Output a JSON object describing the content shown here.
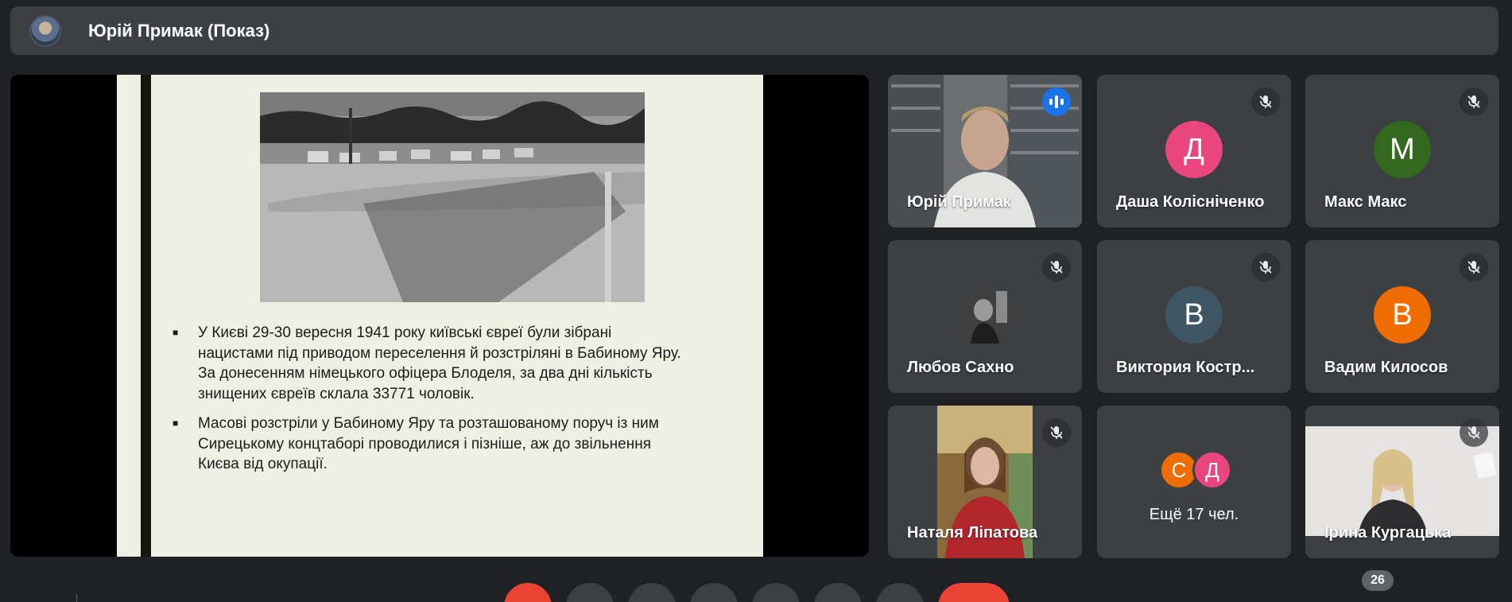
{
  "header": {
    "presenter_title": "Юрій Примак (Показ)"
  },
  "slide": {
    "bullets": [
      "У Києві 29-30 вересня 1941 року київські євреї були зібрані\nнацистами під приводом переселення й розстріляні в Бабиному Яру.\nЗа донесенням німецького офіцера Блоделя, за два дні кількість\nзнищених євреїв склала 33771 чоловік.",
      "Масові розстріли у Бабиному Яру та розташованому поруч із ним\nСирецькому концтаборі проводилися і пізніше, аж до звільнення\nКиєва від окупації."
    ]
  },
  "participants": [
    {
      "name": "Юрій Примак",
      "type": "video",
      "speaking": true
    },
    {
      "name": "Даша Колісніченко",
      "initial": "Д",
      "color": "#e8467c",
      "muted": true
    },
    {
      "name": "Макс Макс",
      "initial": "M",
      "color": "#33691e",
      "muted": true
    },
    {
      "name": "Любов Сахно",
      "type": "photo",
      "muted": true
    },
    {
      "name": "Виктория Костр...",
      "initial": "В",
      "color": "#3e5564",
      "muted": true
    },
    {
      "name": "Вадим Килосов",
      "initial": "В",
      "color": "#ef6c00",
      "muted": true
    },
    {
      "name": "Наталя Ліпатова",
      "type": "video",
      "muted": true
    },
    {
      "more_initials": [
        "С",
        "Д"
      ],
      "more_colors": [
        "#ef6c00",
        "#e8467c"
      ],
      "label": "Ещё 17 чел."
    },
    {
      "name": "Ірина Кургацька",
      "type": "video",
      "muted": true
    }
  ],
  "controls": {
    "participant_count": "26"
  },
  "icons": {
    "mic_off": "mic-off-icon",
    "speaking": "speaking-indicator-icon"
  },
  "colors": {
    "background": "#202124",
    "tile": "#3c4043",
    "active_outline": "#8ab4f8",
    "end_call": "#ea4335"
  }
}
